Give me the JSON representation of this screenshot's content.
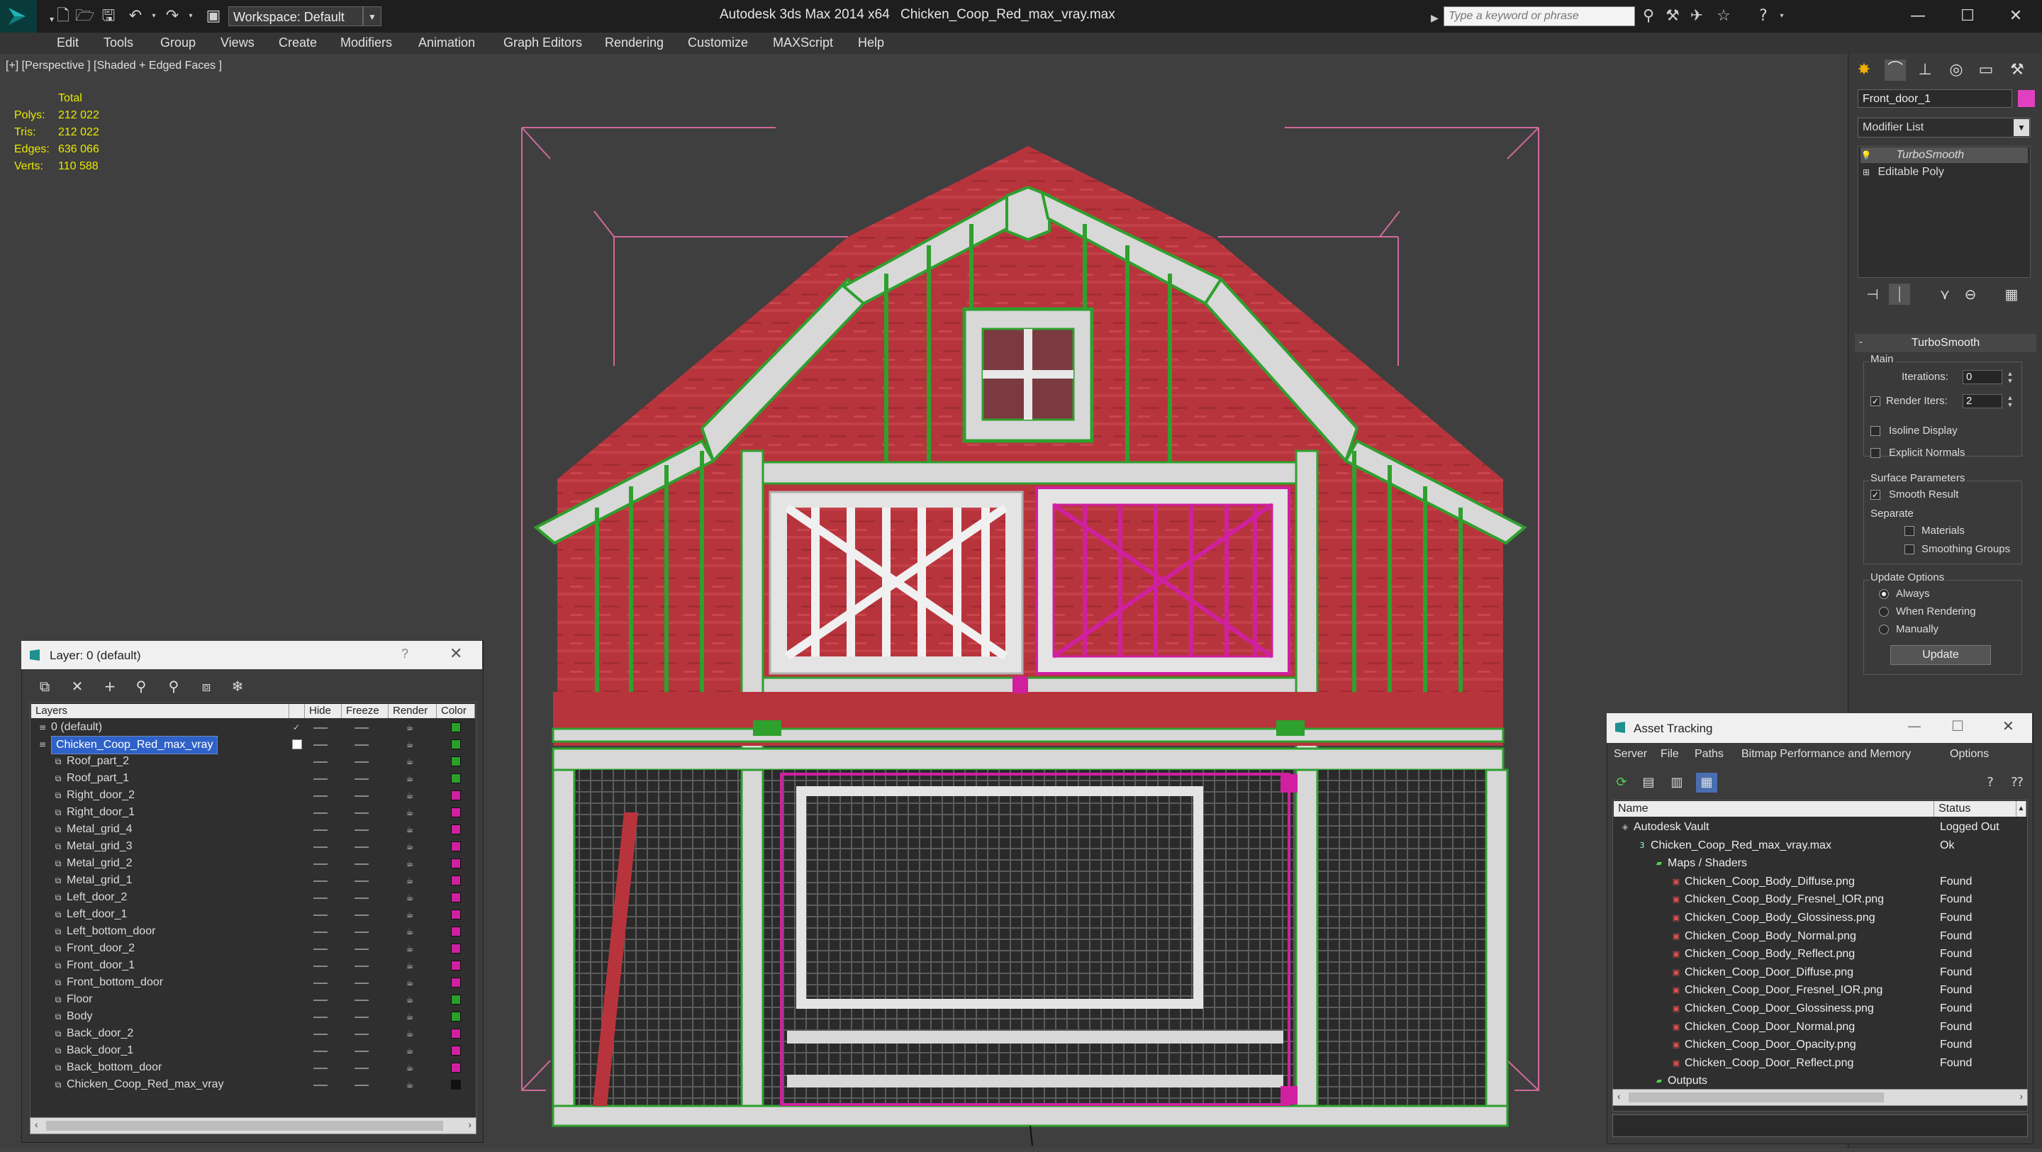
{
  "titlebar": {
    "workspace": "Workspace: Default",
    "app_title": "Autodesk 3ds Max  2014 x64",
    "file_title": "Chicken_Coop_Red_max_vray.max",
    "search_placeholder": "Type a keyword or phrase"
  },
  "menu": [
    "Edit",
    "Tools",
    "Group",
    "Views",
    "Create",
    "Modifiers",
    "Animation",
    "Graph Editors",
    "Rendering",
    "Customize",
    "MAXScript",
    "Help"
  ],
  "viewport": {
    "label": "[+] [Perspective ] [Shaded + Edged Faces ]",
    "stats_header": "Total",
    "stats": [
      {
        "label": "Polys:",
        "value": "212 022"
      },
      {
        "label": "Tris:",
        "value": "212 022"
      },
      {
        "label": "Edges:",
        "value": "636 066"
      },
      {
        "label": "Verts:",
        "value": "110 588"
      }
    ]
  },
  "command_panel": {
    "object_name": "Front_door_1",
    "object_color": "#e040c0",
    "modifier_list": "Modifier List",
    "stack": [
      "TurboSmooth",
      "Editable Poly"
    ],
    "rollout_title": "TurboSmooth",
    "main_group": "Main",
    "iterations_label": "Iterations:",
    "iterations_value": "0",
    "render_iters_label": "Render Iters:",
    "render_iters_value": "2",
    "isoline_label": "Isoline Display",
    "explicit_normals_label": "Explicit Normals",
    "surface_group": "Surface Parameters",
    "smooth_result_label": "Smooth Result",
    "separate_label": "Separate",
    "materials_label": "Materials",
    "smoothing_groups_label": "Smoothing Groups",
    "update_group": "Update Options",
    "always_label": "Always",
    "when_rendering_label": "When Rendering",
    "manually_label": "Manually",
    "update_button": "Update"
  },
  "layer_panel": {
    "title": "Layer: 0 (default)",
    "help": "?",
    "columns": [
      "Layers",
      "Hide",
      "Freeze",
      "Render",
      "Color"
    ],
    "rows": [
      {
        "name": "0 (default)",
        "color": "#2aa02a",
        "indent": 0,
        "checked": true
      },
      {
        "name": "Chicken_Coop_Red_max_vray",
        "color": "#2aa02a",
        "indent": 0,
        "selected": true
      },
      {
        "name": "Roof_part_2",
        "color": "#2aa02a",
        "indent": 1
      },
      {
        "name": "Roof_part_1",
        "color": "#2aa02a",
        "indent": 1
      },
      {
        "name": "Right_door_2",
        "color": "#d020a0",
        "indent": 1
      },
      {
        "name": "Right_door_1",
        "color": "#d020a0",
        "indent": 1
      },
      {
        "name": "Metal_grid_4",
        "color": "#d020a0",
        "indent": 1
      },
      {
        "name": "Metal_grid_3",
        "color": "#d020a0",
        "indent": 1
      },
      {
        "name": "Metal_grid_2",
        "color": "#d020a0",
        "indent": 1
      },
      {
        "name": "Metal_grid_1",
        "color": "#d020a0",
        "indent": 1
      },
      {
        "name": "Left_door_2",
        "color": "#d020a0",
        "indent": 1
      },
      {
        "name": "Left_door_1",
        "color": "#d020a0",
        "indent": 1
      },
      {
        "name": "Left_bottom_door",
        "color": "#d020a0",
        "indent": 1
      },
      {
        "name": "Front_door_2",
        "color": "#d020a0",
        "indent": 1
      },
      {
        "name": "Front_door_1",
        "color": "#d020a0",
        "indent": 1
      },
      {
        "name": "Front_bottom_door",
        "color": "#d020a0",
        "indent": 1
      },
      {
        "name": "Floor",
        "color": "#2aa02a",
        "indent": 1
      },
      {
        "name": "Body",
        "color": "#2aa02a",
        "indent": 1
      },
      {
        "name": "Back_door_2",
        "color": "#d020a0",
        "indent": 1
      },
      {
        "name": "Back_door_1",
        "color": "#d020a0",
        "indent": 1
      },
      {
        "name": "Back_bottom_door",
        "color": "#d020a0",
        "indent": 1
      },
      {
        "name": "Chicken_Coop_Red_max_vray",
        "color": "#111111",
        "indent": 1
      }
    ]
  },
  "asset_tracking": {
    "title": "Asset Tracking",
    "menu": [
      "Server",
      "File",
      "Paths",
      "Bitmap Performance and Memory",
      "Options"
    ],
    "columns": [
      "Name",
      "Status"
    ],
    "rows": [
      {
        "name": "Autodesk Vault",
        "status": "Logged Out",
        "indent": 0,
        "icon": "vault"
      },
      {
        "name": "Chicken_Coop_Red_max_vray.max",
        "status": "Ok",
        "indent": 1,
        "icon": "max"
      },
      {
        "name": "Maps / Shaders",
        "status": "",
        "indent": 2,
        "icon": "folder"
      },
      {
        "name": "Chicken_Coop_Body_Diffuse.png",
        "status": "Found",
        "indent": 3,
        "icon": "image"
      },
      {
        "name": "Chicken_Coop_Body_Fresnel_IOR.png",
        "status": "Found",
        "indent": 3,
        "icon": "image"
      },
      {
        "name": "Chicken_Coop_Body_Glossiness.png",
        "status": "Found",
        "indent": 3,
        "icon": "image"
      },
      {
        "name": "Chicken_Coop_Body_Normal.png",
        "status": "Found",
        "indent": 3,
        "icon": "image"
      },
      {
        "name": "Chicken_Coop_Body_Reflect.png",
        "status": "Found",
        "indent": 3,
        "icon": "image"
      },
      {
        "name": "Chicken_Coop_Door_Diffuse.png",
        "status": "Found",
        "indent": 3,
        "icon": "image"
      },
      {
        "name": "Chicken_Coop_Door_Fresnel_IOR.png",
        "status": "Found",
        "indent": 3,
        "icon": "image"
      },
      {
        "name": "Chicken_Coop_Door_Glossiness.png",
        "status": "Found",
        "indent": 3,
        "icon": "image"
      },
      {
        "name": "Chicken_Coop_Door_Normal.png",
        "status": "Found",
        "indent": 3,
        "icon": "image"
      },
      {
        "name": "Chicken_Coop_Door_Opacity.png",
        "status": "Found",
        "indent": 3,
        "icon": "image"
      },
      {
        "name": "Chicken_Coop_Door_Reflect.png",
        "status": "Found",
        "indent": 3,
        "icon": "image"
      },
      {
        "name": "Outputs",
        "status": "",
        "indent": 2,
        "icon": "folder"
      }
    ]
  }
}
